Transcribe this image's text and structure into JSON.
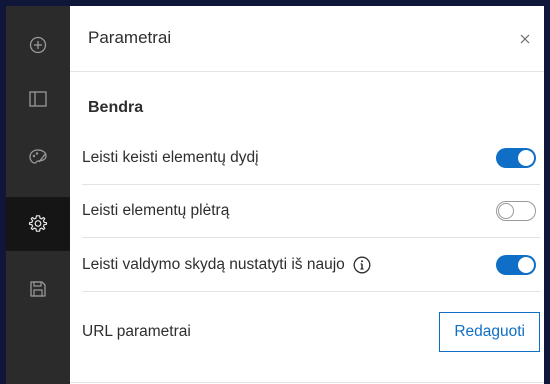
{
  "sidebar": {
    "items": [
      {
        "icon": "add-circle-icon"
      },
      {
        "icon": "layout-panel-icon"
      },
      {
        "icon": "palette-icon"
      },
      {
        "icon": "gear-icon",
        "active": true
      },
      {
        "icon": "save-icon"
      }
    ]
  },
  "panel": {
    "title": "Parametrai",
    "close_icon": "close-icon",
    "section_title": "Bendra",
    "settings": [
      {
        "label": "Leisti keisti elementų dydį",
        "enabled": true
      },
      {
        "label": "Leisti elementų plėtrą",
        "enabled": false
      },
      {
        "label": "Leisti valdymo skydą nustatyti iš naujo",
        "enabled": true,
        "info_icon": "info-icon"
      }
    ],
    "url_row": {
      "label": "URL parametrai",
      "button_label": "Redaguoti"
    }
  },
  "colors": {
    "accent": "#0f6fc6",
    "sidebar": "#2b2b2b",
    "sidebar_active": "#151515",
    "background": "#10163a"
  }
}
